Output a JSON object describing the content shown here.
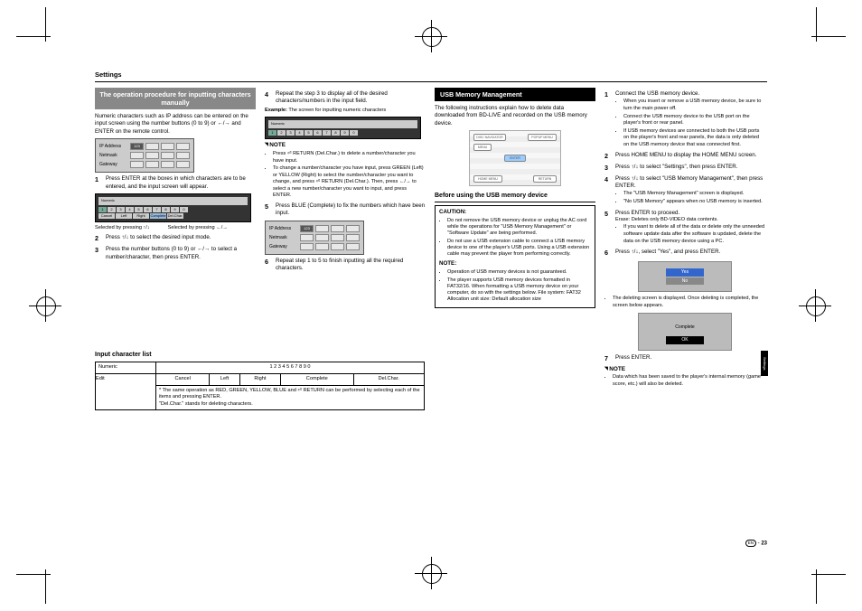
{
  "header": "Settings",
  "sideTab": "Settings",
  "footer": {
    "lang": "EN",
    "sep": "-",
    "page": "23"
  },
  "col1": {
    "title": "The operation procedure for inputting characters manually",
    "intro": "Numeric characters such as IP address can be entered on the input screen using the number buttons (0 to 9) or ←/→ and ENTER on the remote control.",
    "ipbox": {
      "rows": [
        "IP Address",
        "Netmask",
        "Gateway"
      ],
      "numCell": "123"
    },
    "steps": [
      "Press ENTER at the boxes in which characters are to be entered, and the input screen will appear.",
      "Press ↑/↓ to select the desired input mode.",
      "Press the number buttons (0 to 9) or ←/→ to select a number/character, then press ENTER."
    ],
    "selectNote": {
      "a": "Selected by pressing ↑/↓",
      "b": "Selected by pressing ←/→"
    },
    "kb": {
      "field": "Numeric",
      "row1": [
        "1",
        "2",
        "3",
        "4",
        "5",
        "6",
        "7",
        "8",
        "9",
        "0"
      ],
      "row2": [
        "Cancel",
        "Left",
        "Right",
        "Complete",
        "Del.Char."
      ]
    }
  },
  "col2": {
    "step4": "Repeat the step 3 to display all of the desired characters/numbers in the input field.",
    "exampleLabel": "Example:",
    "exampleText": "The screen for inputting numeric characters",
    "noteHead": "NOTE",
    "notes": [
      "Press ⏎ RETURN (Del.Char.) to delete a number/character you have input.",
      "To change a number/character you have input, press GREEN (Left) or YELLOW (Right) to select the number/character you want to change, and press ⏎ RETURN (Del.Char.). Then, press ←/→ to select a new number/character you want to input, and press ENTER."
    ],
    "step5": "Press BLUE (Complete) to fix the numbers which have been input.",
    "step6": "Repeat step 1 to 5 to finish inputting all the required characters."
  },
  "inputList": {
    "heading": "Input character list",
    "rowALabel": "Numeric",
    "rowAValue": "1 2 3 4 5 6 7 8 9 0",
    "rowBLabel": "Edit",
    "buttons": [
      "Cancel",
      "Left",
      "Right",
      "Complete",
      "Del.Char."
    ],
    "note": "* The same operation as RED, GREEN, YELLOW, BLUE and ⏎ RETURN can be performed by selecting each of the items and pressing ENTER.\n\"Del.Char.\" stands for deleting characters."
  },
  "col3": {
    "title": "USB Memory Management",
    "intro": "The following instructions explain how to delete data downloaded from BD-LIVE and recorded on the USB memory device.",
    "remote": {
      "labels": [
        "DISC NAVIGATOR",
        "POPUP MENU",
        "MENU",
        "ENTER",
        "HOME MENU",
        "RETURN"
      ]
    },
    "sub": "Before using the USB memory device",
    "caution": {
      "head": "CAUTION:",
      "items": [
        "Do not remove the USB memory device or unplug the AC cord while the operations for \"USB Memory Management\" or \"Software Update\" are being performed.",
        "Do not use a USB extension cable to connect a USB memory device to one of the player's USB ports. Using a USB extension cable may prevent the player from performing correctly."
      ],
      "noteHead": "NOTE:",
      "noteItems": [
        "Operation of USB memory devices is not guaranteed.",
        "The player supports USB memory devices formatted in FAT32/16. When formatting a USB memory device on your computer, do so with the settings below.\nFile system: FAT32\nAllocation unit size: Default allocation size"
      ]
    }
  },
  "col4": {
    "steps": [
      {
        "n": "1",
        "t": "Connect the USB memory device.",
        "sub": [
          "When you insert or remove a USB memory device, be sure to turn the main power off.",
          "Connect the USB memory device to the USB port on the player's front or rear panel.",
          "If USB memory devices are connected to both the USB ports on the player's front and rear panels, the data is only deleted on the USB memory device that was connected first."
        ]
      },
      {
        "n": "2",
        "t": "Press HOME MENU to display the HOME MENU screen."
      },
      {
        "n": "3",
        "t": "Press ↑/↓ to select \"Settings\", then press ENTER."
      },
      {
        "n": "4",
        "t": "Press ↑/↓ to select \"USB Memory Management\", then press ENTER.",
        "sub": [
          "The \"USB Memory Management\" screen is displayed.",
          "\"No USB Memory\" appears when no USB memory is inserted."
        ]
      },
      {
        "n": "5",
        "t": "Press ENTER to proceed.",
        "plain": "Erase: Deletes only BD-VIDEO data contents.",
        "sub": [
          "If you want to delete all of the data or delete only the unneeded software update data after the software is updated, delete the data on the USB memory device using a PC."
        ]
      },
      {
        "n": "6",
        "t": "Press ↑/↓, select \"Yes\", and press ENTER."
      }
    ],
    "confirm1": {
      "yes": "Yes",
      "no": "No"
    },
    "afterConfirm": "The deleting screen is displayed. Once deleting is completed, the screen below appears.",
    "confirm2": {
      "txt": "Complete",
      "ok": "OK"
    },
    "step7": "Press ENTER.",
    "noteHead": "NOTE",
    "noteItem": "Data which has been saved to the player's internal memory (game score, etc.) will also be deleted."
  }
}
